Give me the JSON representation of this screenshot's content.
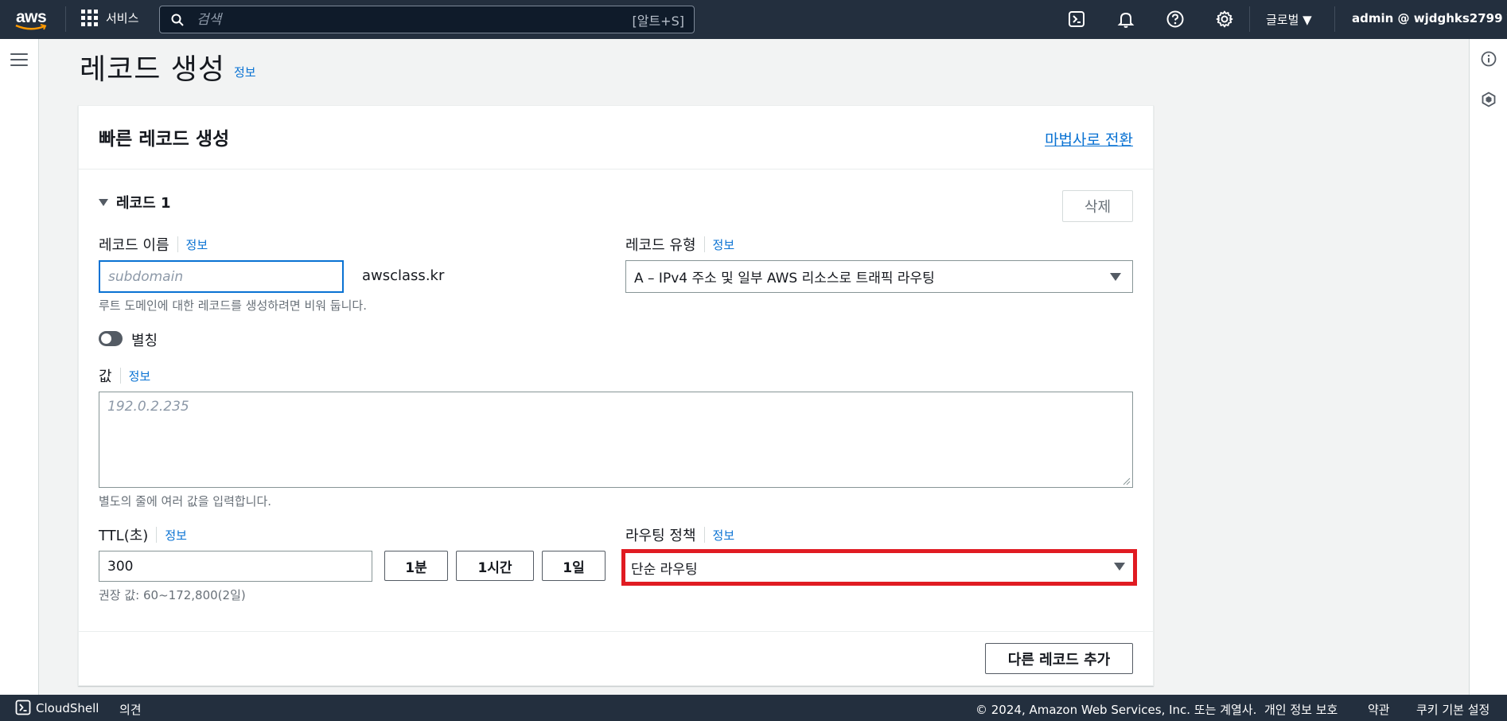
{
  "topnav": {
    "logo_text": "aws",
    "services_label": "서비스",
    "search_placeholder": "검색",
    "search_shortcut": "[알트+S]",
    "region_label": "글로벌 ▼",
    "account_label": "admin @ wjdghks2799 ▼"
  },
  "page": {
    "title": "레코드 생성",
    "title_info": "정보"
  },
  "card": {
    "title": "빠른 레코드 생성",
    "wizard_link": "마법사로 전환",
    "record_heading": "레코드 1",
    "delete_label": "삭제",
    "record_name_label": "레코드 이름",
    "record_name_info": "정보",
    "record_name_placeholder": "subdomain",
    "record_name_value": "",
    "domain_suffix": "awsclass.kr",
    "record_name_hint": "루트 도메인에 대한 레코드를 생성하려면 비워 둡니다.",
    "record_type_label": "레코드 유형",
    "record_type_info": "정보",
    "record_type_value": "A – IPv4 주소 및 일부 AWS 리소스로 트래픽 라우팅",
    "alias_label": "별칭",
    "alias_enabled": false,
    "value_label": "값",
    "value_info": "정보",
    "value_placeholder": "192.0.2.235",
    "value_hint": "별도의 줄에 여러 값을 입력합니다.",
    "ttl_label": "TTL(초)",
    "ttl_info": "정보",
    "ttl_value": "300",
    "ttl_presets": [
      "1분",
      "1시간",
      "1일"
    ],
    "ttl_hint": "권장 값: 60~172,800(2일)",
    "routing_label": "라우팅 정책",
    "routing_info": "정보",
    "routing_value": "단순 라우팅",
    "add_record_label": "다른 레코드 추가"
  },
  "footer": {
    "cloudshell": "CloudShell",
    "feedback": "의견",
    "copyright": "© 2024, Amazon Web Services, Inc. 또는 계열사.",
    "privacy": "개인 정보 보호",
    "terms": "약관",
    "cookies": "쿠키 기본 설정"
  },
  "colors": {
    "nav_bg": "#232f3e",
    "link": "#0972d3",
    "highlight": "#e01b22",
    "page_bg": "#f2f3f3"
  },
  "icons": [
    "aws-logo",
    "services-grid-icon",
    "search-icon",
    "cloudshell-icon",
    "notifications-bell-icon",
    "help-icon",
    "settings-gear-icon",
    "menu-hamburger-icon",
    "info-panel-icon",
    "feature-hexagon-icon",
    "caret-down-icon",
    "resize-grip-icon"
  ]
}
